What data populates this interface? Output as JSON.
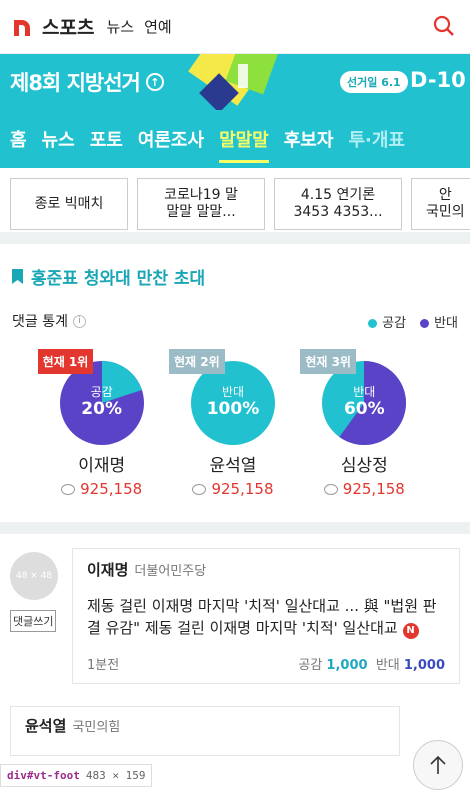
{
  "header": {
    "brand": "스포츠",
    "nav": [
      "뉴스",
      "연예"
    ]
  },
  "banner": {
    "title": "제8회 지방선거",
    "election_day": "선거일 6.1",
    "dday": "D-10"
  },
  "tabs": [
    "홈",
    "뉴스",
    "포토",
    "여론조사",
    "말말말",
    "후보자",
    "투·개표"
  ],
  "active_tab": "말말말",
  "chips": [
    "종로 빅매치",
    "코로나19 말\n말말 말말...",
    "4.15 연기론\n3453 4353...",
    "안\n국민의"
  ],
  "topic": "홍준표 청와대 만찬 초대",
  "stats": {
    "title": "댓글 통계",
    "legend": [
      "공감",
      "반대"
    ],
    "colors": {
      "agree": "#22c1d0",
      "oppose": "#5b43c7"
    }
  },
  "candidates": [
    {
      "rank": "현재 1위",
      "rank_color": "#e2362e",
      "label": "공감",
      "pct": "20%",
      "agree_pct": 20,
      "name": "이재명",
      "count": "925,158"
    },
    {
      "rank": "현재 2위",
      "rank_color": "#9bbcc7",
      "label": "반대",
      "pct": "100%",
      "agree_pct": 100,
      "name": "윤석열",
      "count": "925,158"
    },
    {
      "rank": "현재 3위",
      "rank_color": "#9bbcc7",
      "label": "반대",
      "pct": "60%",
      "agree_pct": 60,
      "name": "심상정",
      "count": "925,158"
    }
  ],
  "comment": {
    "avatar": "48 × 48",
    "reply": "댓글쓰기",
    "author": "이재명",
    "party": "더불어민주당",
    "text": "제동 걸린 이재명 마지막 '치적' 일산대교 ... 與 \"법원 판결 유감\" 제동 걸린 이재명 마지막 '치적' 일산대교",
    "time": "1분전",
    "agree_label": "공감",
    "agree": "1,000",
    "oppose_label": "반대",
    "oppose": "1,000"
  },
  "comment2": {
    "author": "윤석열",
    "party": "국민의힘"
  },
  "devtool": {
    "sel": "div#vt-foot",
    "size": "483 × 159"
  }
}
